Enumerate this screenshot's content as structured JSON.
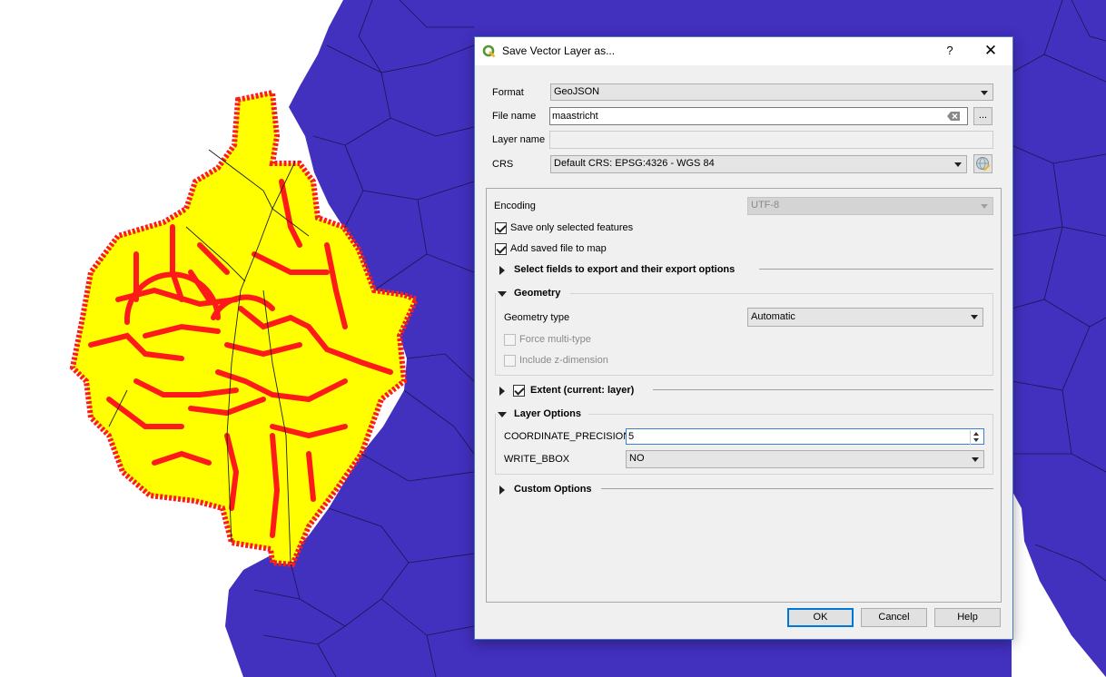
{
  "dialog": {
    "title": "Save Vector Layer as...",
    "help_glyph": "?",
    "close_glyph": "✕"
  },
  "form": {
    "format_label": "Format",
    "format_value": "GeoJSON",
    "filename_label": "File name",
    "filename_value": "maastricht",
    "browse_label": "...",
    "layername_label": "Layer name",
    "layername_value": "",
    "crs_label": "CRS",
    "crs_value": "Default CRS: EPSG:4326 - WGS 84"
  },
  "options": {
    "encoding_label": "Encoding",
    "encoding_value": "UTF-8",
    "save_selected_label": "Save only selected features",
    "save_selected_checked": true,
    "add_to_map_label": "Add saved file to map",
    "add_to_map_checked": true,
    "select_fields_label": "Select fields to export and their export options",
    "geometry": {
      "title": "Geometry",
      "type_label": "Geometry type",
      "type_value": "Automatic",
      "force_multi_label": "Force multi-type",
      "include_z_label": "Include z-dimension"
    },
    "extent_label": "Extent (current: layer)",
    "extent_checked": true,
    "layer_options": {
      "title": "Layer Options",
      "coord_precision_label": "COORDINATE_PRECISION",
      "coord_precision_value": "5",
      "write_bbox_label": "WRITE_BBOX",
      "write_bbox_value": "NO"
    },
    "custom_options_label": "Custom Options"
  },
  "buttons": {
    "ok": "OK",
    "cancel": "Cancel",
    "help": "Help"
  },
  "colors": {
    "map_background": "#ffffff",
    "polygon_fill": "#4230bf",
    "selection_fill": "#ffff00",
    "selection_outline": "#ff1a1a",
    "qgis_logo": "#589632"
  }
}
